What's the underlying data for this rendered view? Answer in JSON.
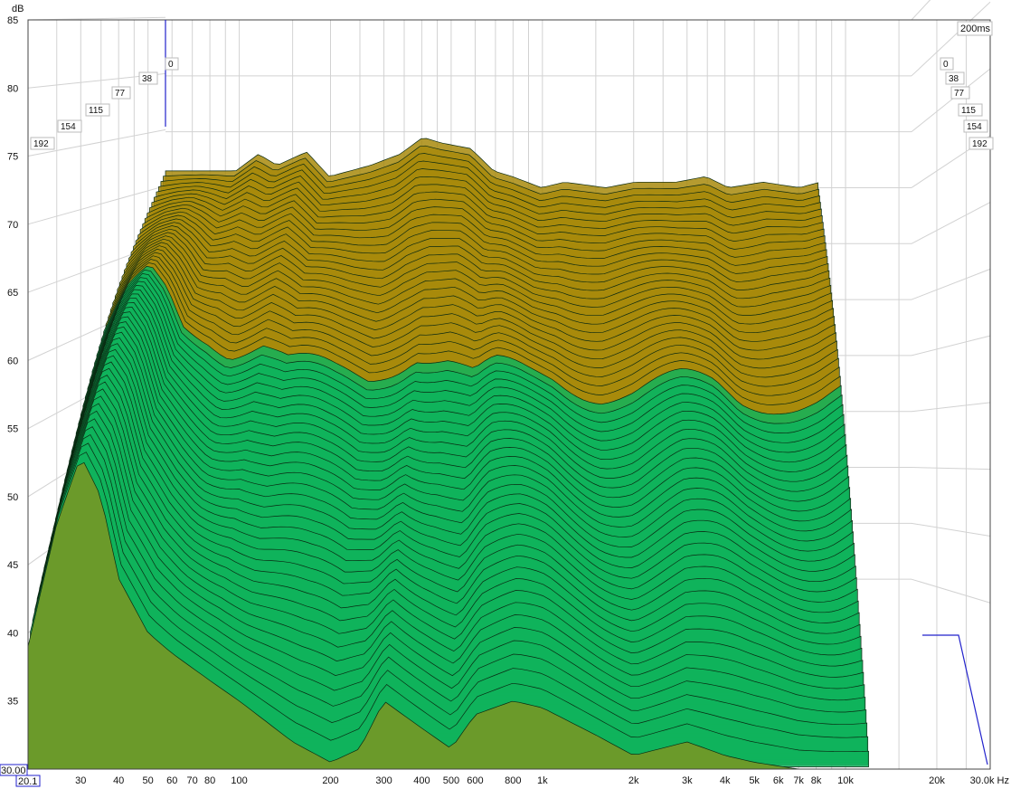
{
  "chart_data": {
    "type": "waterfall",
    "ylabel": "dB",
    "x_unit": "Hz",
    "time_window_label": "200ms",
    "corner_value": "30.00",
    "x_start_label": "20.1",
    "x_ticks": [
      {
        "v": 30,
        "label": "30"
      },
      {
        "v": 40,
        "label": "40"
      },
      {
        "v": 50,
        "label": "50"
      },
      {
        "v": 60,
        "label": "60"
      },
      {
        "v": 70,
        "label": "70"
      },
      {
        "v": 80,
        "label": "80"
      },
      {
        "v": 100,
        "label": "100"
      },
      {
        "v": 200,
        "label": "200"
      },
      {
        "v": 300,
        "label": "300"
      },
      {
        "v": 400,
        "label": "400"
      },
      {
        "v": 500,
        "label": "500"
      },
      {
        "v": 600,
        "label": "600"
      },
      {
        "v": 800,
        "label": "800"
      },
      {
        "v": 1000,
        "label": "1k"
      },
      {
        "v": 2000,
        "label": "2k"
      },
      {
        "v": 3000,
        "label": "3k"
      },
      {
        "v": 4000,
        "label": "4k"
      },
      {
        "v": 5000,
        "label": "5k"
      },
      {
        "v": 6000,
        "label": "6k"
      },
      {
        "v": 7000,
        "label": "7k"
      },
      {
        "v": 8000,
        "label": "8k"
      },
      {
        "v": 10000,
        "label": "10k"
      },
      {
        "v": 20000,
        "label": "20k"
      },
      {
        "v": 30000,
        "label": "30.0k Hz"
      }
    ],
    "y_ticks": [
      35,
      40,
      45,
      50,
      55,
      60,
      65,
      70,
      75,
      80,
      85
    ],
    "ylim": [
      30,
      85
    ],
    "xlim": [
      20.1,
      30000
    ],
    "time_ticks_ms": [
      {
        "v": 0,
        "label": "0"
      },
      {
        "v": 38,
        "label": "38"
      },
      {
        "v": 77,
        "label": "77"
      },
      {
        "v": 115,
        "label": "115"
      },
      {
        "v": 154,
        "label": "154"
      },
      {
        "v": 192,
        "label": "192"
      }
    ],
    "colors": {
      "front_slice": "#6b9a2a",
      "early_slices": "#a88a0c",
      "later_slices": "#0fb35c",
      "frame": "#2222cc"
    },
    "front_slice": {
      "time_ms": 0,
      "x": [
        20.1,
        25,
        30,
        35,
        40,
        50,
        60,
        80,
        100,
        150,
        200,
        250,
        300,
        400,
        500,
        600,
        800,
        1000,
        1500,
        2000,
        3000,
        4000,
        5000,
        7000,
        10000
      ],
      "y": [
        39,
        48,
        53,
        50,
        44,
        40,
        38.5,
        36.5,
        35,
        32,
        30.5,
        31.5,
        35,
        33,
        31.5,
        34,
        35,
        34.5,
        32.5,
        31,
        32,
        31,
        30.5,
        30,
        30
      ]
    },
    "back_slice": {
      "time_ms": 200,
      "x": [
        40,
        50,
        60,
        80,
        100,
        150,
        200,
        250,
        300,
        400,
        500,
        600,
        800,
        1000,
        1500,
        2000,
        3000,
        4000,
        5000,
        7000,
        10000,
        15000,
        20000
      ],
      "y": [
        71.5,
        73,
        72,
        73.2,
        71,
        72,
        73,
        74.5,
        74,
        73.5,
        71.5,
        71,
        70,
        70.5,
        70,
        70.5,
        70.5,
        71,
        70,
        70.5,
        70,
        71,
        73.5
      ]
    }
  }
}
